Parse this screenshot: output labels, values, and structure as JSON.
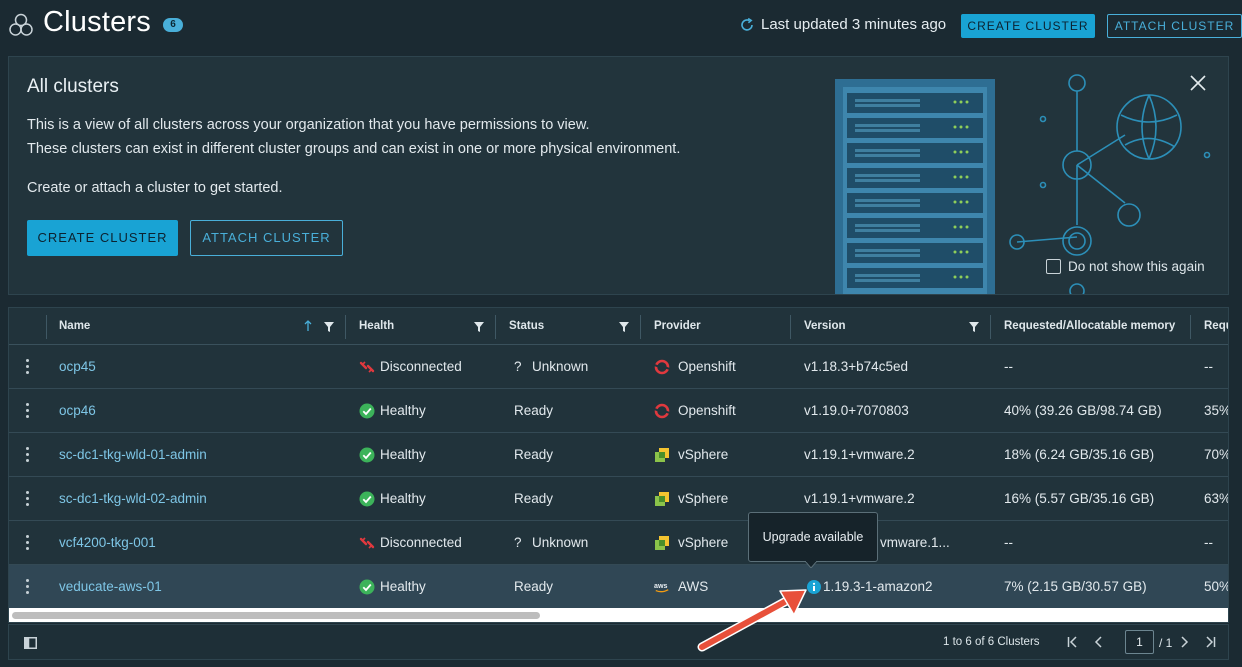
{
  "header": {
    "title": "Clusters",
    "count_badge": "6",
    "last_updated": "Last updated 3 minutes ago",
    "create_label": "CREATE CLUSTER",
    "attach_label": "ATTACH CLUSTER"
  },
  "banner": {
    "title": "All clusters",
    "line1": "This is a view of all clusters across your organization that you have permissions to view.",
    "line2": "These clusters can exist in different cluster groups and can exist in one or more physical environment.",
    "line3": "Create or attach a cluster to get started.",
    "create_label": "CREATE CLUSTER",
    "attach_label": "ATTACH CLUSTER",
    "dont_show_label": "Do not show this again"
  },
  "table": {
    "columns": [
      "Name",
      "Health",
      "Status",
      "Provider",
      "Version",
      "Requested/Allocatable memory",
      "Requ"
    ],
    "rows": [
      {
        "name": "ocp45",
        "health": "Disconnected",
        "status": "Unknown",
        "status_prefix": "?",
        "provider": "Openshift",
        "version": "v1.18.3+b74c5ed",
        "memory": "--",
        "req": "--"
      },
      {
        "name": "ocp46",
        "health": "Healthy",
        "status": "Ready",
        "status_prefix": "",
        "provider": "Openshift",
        "version": "v1.19.0+7070803",
        "memory": "40% (39.26 GB/98.74 GB)",
        "req": "35%"
      },
      {
        "name": "sc-dc1-tkg-wld-01-admin",
        "health": "Healthy",
        "status": "Ready",
        "status_prefix": "",
        "provider": "vSphere",
        "version": "v1.19.1+vmware.2",
        "memory": "18% (6.24 GB/35.16 GB)",
        "req": "70%"
      },
      {
        "name": "sc-dc1-tkg-wld-02-admin",
        "health": "Healthy",
        "status": "Ready",
        "status_prefix": "",
        "provider": "vSphere",
        "version": "v1.19.1+vmware.2",
        "memory": "16% (5.57 GB/35.16 GB)",
        "req": "63%"
      },
      {
        "name": "vcf4200-tkg-001",
        "health": "Disconnected",
        "status": "Unknown",
        "status_prefix": "?",
        "provider": "vSphere",
        "version": "vmware.1...",
        "memory": "--",
        "req": "--"
      },
      {
        "name": "veducate-aws-01",
        "health": "Healthy",
        "status": "Ready",
        "status_prefix": "",
        "provider": "AWS",
        "version": "1.19.3-1-amazon2",
        "memory": "7% (2.15 GB/30.57 GB)",
        "req": "50%"
      }
    ]
  },
  "tooltip": "Upgrade available",
  "footer": {
    "range": "1 to 6 of 6 Clusters",
    "page": "1",
    "total": "/ 1"
  },
  "colors": {
    "accent": "#19a3d4",
    "link": "#7ec6e6",
    "healthy": "#3cb35a",
    "disconnected": "#e0393e",
    "annotation_arrow": "#e8503a"
  }
}
